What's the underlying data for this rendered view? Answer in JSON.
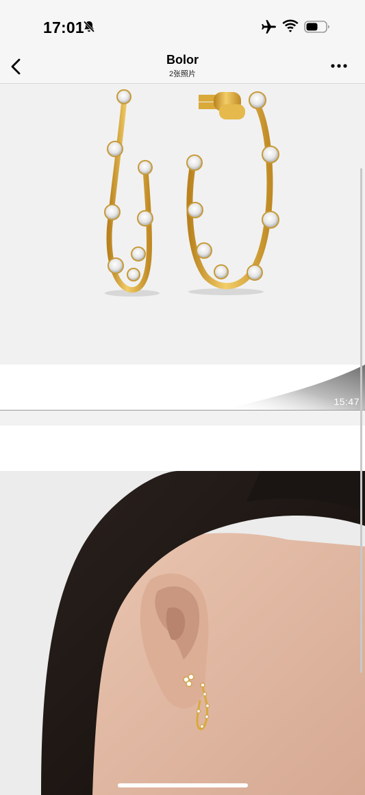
{
  "status_bar": {
    "time": "17:01",
    "icons": [
      "bell-slash-icon",
      "airplane-icon",
      "wifi-icon",
      "battery-icon"
    ]
  },
  "nav": {
    "title": "Bolor",
    "subtitle": "2张照片",
    "back_icon": "chevron-left-icon",
    "more_icon": "more-dots-icon"
  },
  "photos": [
    {
      "name": "gold-hoop-earrings-product-photo"
    },
    {
      "name": "ear-wearing-earrings-photo"
    }
  ],
  "timestamp": "15:47",
  "colors": {
    "gold": "#d9a93a",
    "background": "#f6f6f6",
    "hair": "#1b1614",
    "skin": "#e2bba4"
  }
}
